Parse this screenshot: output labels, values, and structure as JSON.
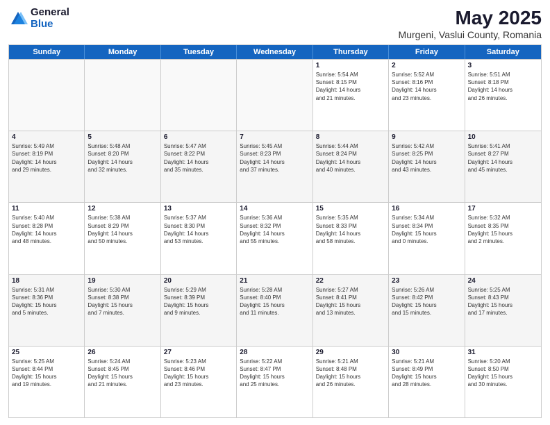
{
  "logo": {
    "general": "General",
    "blue": "Blue"
  },
  "title": "May 2025",
  "subtitle": "Murgeni, Vaslui County, Romania",
  "header_days": [
    "Sunday",
    "Monday",
    "Tuesday",
    "Wednesday",
    "Thursday",
    "Friday",
    "Saturday"
  ],
  "weeks": [
    [
      {
        "day": "",
        "info": ""
      },
      {
        "day": "",
        "info": ""
      },
      {
        "day": "",
        "info": ""
      },
      {
        "day": "",
        "info": ""
      },
      {
        "day": "1",
        "info": "Sunrise: 5:54 AM\nSunset: 8:15 PM\nDaylight: 14 hours\nand 21 minutes."
      },
      {
        "day": "2",
        "info": "Sunrise: 5:52 AM\nSunset: 8:16 PM\nDaylight: 14 hours\nand 23 minutes."
      },
      {
        "day": "3",
        "info": "Sunrise: 5:51 AM\nSunset: 8:18 PM\nDaylight: 14 hours\nand 26 minutes."
      }
    ],
    [
      {
        "day": "4",
        "info": "Sunrise: 5:49 AM\nSunset: 8:19 PM\nDaylight: 14 hours\nand 29 minutes."
      },
      {
        "day": "5",
        "info": "Sunrise: 5:48 AM\nSunset: 8:20 PM\nDaylight: 14 hours\nand 32 minutes."
      },
      {
        "day": "6",
        "info": "Sunrise: 5:47 AM\nSunset: 8:22 PM\nDaylight: 14 hours\nand 35 minutes."
      },
      {
        "day": "7",
        "info": "Sunrise: 5:45 AM\nSunset: 8:23 PM\nDaylight: 14 hours\nand 37 minutes."
      },
      {
        "day": "8",
        "info": "Sunrise: 5:44 AM\nSunset: 8:24 PM\nDaylight: 14 hours\nand 40 minutes."
      },
      {
        "day": "9",
        "info": "Sunrise: 5:42 AM\nSunset: 8:25 PM\nDaylight: 14 hours\nand 43 minutes."
      },
      {
        "day": "10",
        "info": "Sunrise: 5:41 AM\nSunset: 8:27 PM\nDaylight: 14 hours\nand 45 minutes."
      }
    ],
    [
      {
        "day": "11",
        "info": "Sunrise: 5:40 AM\nSunset: 8:28 PM\nDaylight: 14 hours\nand 48 minutes."
      },
      {
        "day": "12",
        "info": "Sunrise: 5:38 AM\nSunset: 8:29 PM\nDaylight: 14 hours\nand 50 minutes."
      },
      {
        "day": "13",
        "info": "Sunrise: 5:37 AM\nSunset: 8:30 PM\nDaylight: 14 hours\nand 53 minutes."
      },
      {
        "day": "14",
        "info": "Sunrise: 5:36 AM\nSunset: 8:32 PM\nDaylight: 14 hours\nand 55 minutes."
      },
      {
        "day": "15",
        "info": "Sunrise: 5:35 AM\nSunset: 8:33 PM\nDaylight: 14 hours\nand 58 minutes."
      },
      {
        "day": "16",
        "info": "Sunrise: 5:34 AM\nSunset: 8:34 PM\nDaylight: 15 hours\nand 0 minutes."
      },
      {
        "day": "17",
        "info": "Sunrise: 5:32 AM\nSunset: 8:35 PM\nDaylight: 15 hours\nand 2 minutes."
      }
    ],
    [
      {
        "day": "18",
        "info": "Sunrise: 5:31 AM\nSunset: 8:36 PM\nDaylight: 15 hours\nand 5 minutes."
      },
      {
        "day": "19",
        "info": "Sunrise: 5:30 AM\nSunset: 8:38 PM\nDaylight: 15 hours\nand 7 minutes."
      },
      {
        "day": "20",
        "info": "Sunrise: 5:29 AM\nSunset: 8:39 PM\nDaylight: 15 hours\nand 9 minutes."
      },
      {
        "day": "21",
        "info": "Sunrise: 5:28 AM\nSunset: 8:40 PM\nDaylight: 15 hours\nand 11 minutes."
      },
      {
        "day": "22",
        "info": "Sunrise: 5:27 AM\nSunset: 8:41 PM\nDaylight: 15 hours\nand 13 minutes."
      },
      {
        "day": "23",
        "info": "Sunrise: 5:26 AM\nSunset: 8:42 PM\nDaylight: 15 hours\nand 15 minutes."
      },
      {
        "day": "24",
        "info": "Sunrise: 5:25 AM\nSunset: 8:43 PM\nDaylight: 15 hours\nand 17 minutes."
      }
    ],
    [
      {
        "day": "25",
        "info": "Sunrise: 5:25 AM\nSunset: 8:44 PM\nDaylight: 15 hours\nand 19 minutes."
      },
      {
        "day": "26",
        "info": "Sunrise: 5:24 AM\nSunset: 8:45 PM\nDaylight: 15 hours\nand 21 minutes."
      },
      {
        "day": "27",
        "info": "Sunrise: 5:23 AM\nSunset: 8:46 PM\nDaylight: 15 hours\nand 23 minutes."
      },
      {
        "day": "28",
        "info": "Sunrise: 5:22 AM\nSunset: 8:47 PM\nDaylight: 15 hours\nand 25 minutes."
      },
      {
        "day": "29",
        "info": "Sunrise: 5:21 AM\nSunset: 8:48 PM\nDaylight: 15 hours\nand 26 minutes."
      },
      {
        "day": "30",
        "info": "Sunrise: 5:21 AM\nSunset: 8:49 PM\nDaylight: 15 hours\nand 28 minutes."
      },
      {
        "day": "31",
        "info": "Sunrise: 5:20 AM\nSunset: 8:50 PM\nDaylight: 15 hours\nand 30 minutes."
      }
    ]
  ]
}
